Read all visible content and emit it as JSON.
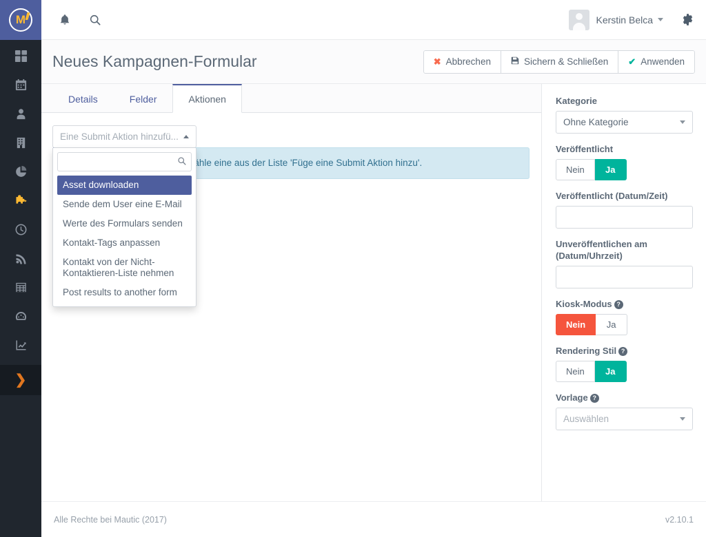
{
  "app": {
    "logo_letter": "M",
    "version": "v2.10.1",
    "copyright": "Alle Rechte bei Mautic (2017)"
  },
  "topbar": {
    "notifications_icon": "bell-icon",
    "search_icon": "search-icon",
    "user_name": "Kerstin Belca",
    "settings_icon": "gear-icon"
  },
  "sidebar": {
    "items": [
      {
        "name": "dashboard",
        "icon": "grid-icon",
        "active": false
      },
      {
        "name": "calendar",
        "icon": "calendar-icon",
        "active": false
      },
      {
        "name": "contacts",
        "icon": "person-icon",
        "active": false
      },
      {
        "name": "companies",
        "icon": "building-icon",
        "active": false
      },
      {
        "name": "segments",
        "icon": "pie-chart-icon",
        "active": false
      },
      {
        "name": "components",
        "icon": "puzzle-icon",
        "active": true
      },
      {
        "name": "campaigns",
        "icon": "clock-icon",
        "active": false
      },
      {
        "name": "channels",
        "icon": "rss-icon",
        "active": false
      },
      {
        "name": "points",
        "icon": "table-icon",
        "active": false
      },
      {
        "name": "stages",
        "icon": "speedometer-icon",
        "active": false
      },
      {
        "name": "reports",
        "icon": "line-chart-icon",
        "active": false
      }
    ],
    "toggle_icon": "chevron-right-icon"
  },
  "page": {
    "title": "Neues Kampagnen-Formular",
    "buttons": [
      {
        "label": "Abbrechen",
        "icon": "x-icon",
        "style": "danger"
      },
      {
        "label": "Sichern & Schließen",
        "icon": "save-icon",
        "style": "default"
      },
      {
        "label": "Anwenden",
        "icon": "check-icon",
        "style": "success"
      }
    ]
  },
  "tabs": [
    {
      "label": "Details",
      "active": false
    },
    {
      "label": "Felder",
      "active": false
    },
    {
      "label": "Aktionen",
      "active": true
    }
  ],
  "actions_tab": {
    "dropdown": {
      "button_label": "Eine Submit Aktion hinzufü...",
      "caret": "caret-up-icon",
      "search_placeholder": "",
      "search_value": "",
      "search_icon": "search-icon",
      "items": [
        {
          "label": "Asset downloaden",
          "selected": true
        },
        {
          "label": "Sende dem User eine E-Mail",
          "selected": false
        },
        {
          "label": "Werte des Formulars senden",
          "selected": false
        },
        {
          "label": "Kontakt-Tags anpassen",
          "selected": false
        },
        {
          "label": "Kontakt von der Nicht-Kontaktieren-Liste nehmen",
          "selected": false
        },
        {
          "label": "Post results to another form",
          "selected": false
        }
      ]
    },
    "alert_text": "Um eine Aktion hinzuzufügen wähle eine aus der Liste 'Füge eine Submit Aktion hinzu'."
  },
  "right_panel": {
    "category": {
      "label": "Kategorie",
      "value": "Ohne Kategorie",
      "caret": "caret-down-icon"
    },
    "published": {
      "label": "Veröffentlicht",
      "options": [
        "Nein",
        "Ja"
      ],
      "selected": "Ja"
    },
    "publish_at": {
      "label": "Veröffentlicht (Datum/Zeit)",
      "value": "",
      "placeholder": ""
    },
    "unpublish_at": {
      "label": "Unveröffentlichen am (Datum/Uhrzeit)",
      "value": "",
      "placeholder": ""
    },
    "kiosk_mode": {
      "label": "Kiosk-Modus",
      "help_icon": "question-circle-icon",
      "options": [
        "Nein",
        "Ja"
      ],
      "selected": "Nein"
    },
    "rendering_style": {
      "label": "Rendering Stil",
      "help_icon": "question-circle-icon",
      "options": [
        "Nein",
        "Ja"
      ],
      "selected": "Ja"
    },
    "template": {
      "label": "Vorlage",
      "help_icon": "question-circle-icon",
      "value": "Auswählen",
      "caret": "caret-down-icon"
    }
  },
  "colors": {
    "brand_blue": "#4e5e9e",
    "sidebar_dark": "#20262e",
    "accent_orange": "#fdb933",
    "success_teal": "#00b49c",
    "danger_red": "#f5553d",
    "info_bg": "#d4e9f2"
  }
}
